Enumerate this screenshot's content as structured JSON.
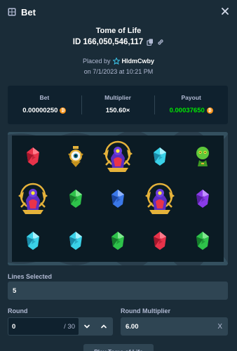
{
  "header": {
    "title": "Bet",
    "icon": "bet-ticket-icon",
    "close_icon": "close-icon"
  },
  "bet": {
    "game_name": "Tome of Life",
    "id_text": "ID 166,050,546,117",
    "placed_by_label": "Placed by",
    "username": "HldmCwby",
    "date": "on 7/1/2023 at 10:21 PM"
  },
  "stats": {
    "bet_label": "Bet",
    "bet_value": "0.00000250",
    "multiplier_label": "Multiplier",
    "multiplier_value": "150.60×",
    "payout_label": "Payout",
    "payout_value": "0.00037650",
    "coin_icon": "bitcoin-icon",
    "colors": {
      "payout": "#00e701",
      "panel": "#0f212e",
      "background": "#1a2c38"
    }
  },
  "reels": {
    "grid": [
      [
        "red-gem",
        "eye-scarab",
        "pharaoh-bird",
        "cyan-gem",
        "green-cobra"
      ],
      [
        "pharaoh-bird",
        "green-gem",
        "blue-gem",
        "pharaoh-bird",
        "purple-gem"
      ],
      [
        "cyan-gem",
        "cyan-gem",
        "green-gem",
        "red-gem",
        "green-gem"
      ]
    ]
  },
  "lines": {
    "label": "Lines Selected",
    "value": "5"
  },
  "round": {
    "label": "Round",
    "value": "0",
    "total": "/ 30"
  },
  "round_multiplier": {
    "label": "Round Multiplier",
    "value": "6.00",
    "clear": "X"
  },
  "bottom_button": {
    "label": "Play Tome of Life"
  }
}
